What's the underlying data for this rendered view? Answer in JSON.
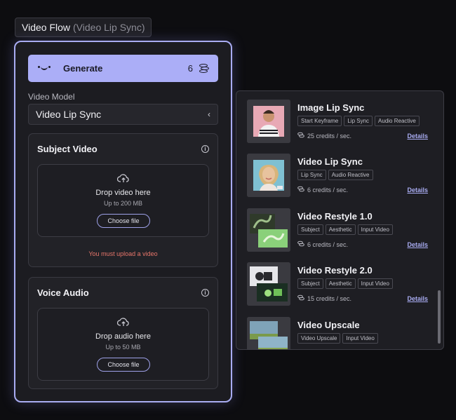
{
  "header": {
    "title": "Video Flow",
    "subtitle": "(Video Lip Sync)"
  },
  "generate": {
    "label": "Generate",
    "count": "6"
  },
  "model": {
    "label": "Video Model",
    "value": "Video Lip Sync"
  },
  "subject": {
    "title": "Subject Video",
    "drop_text": "Drop video here",
    "limit": "Up to 200 MB",
    "choose": "Choose file",
    "error": "You must upload a video"
  },
  "voice": {
    "title": "Voice Audio",
    "drop_text": "Drop audio here",
    "limit": "Up to 50 MB",
    "choose": "Choose file"
  },
  "models": [
    {
      "name": "Image Lip Sync",
      "tags": [
        "Start Keyframe",
        "Lip Sync",
        "Audio Reactive"
      ],
      "credits": "25 credits / sec.",
      "details": "Details"
    },
    {
      "name": "Video Lip Sync",
      "tags": [
        "Lip Sync",
        "Audio Reactive"
      ],
      "credits": "6 credits / sec.",
      "details": "Details"
    },
    {
      "name": "Video Restyle 1.0",
      "tags": [
        "Subject",
        "Aesthetic",
        "Input Video"
      ],
      "credits": "6 credits / sec.",
      "details": "Details"
    },
    {
      "name": "Video Restyle 2.0",
      "tags": [
        "Subject",
        "Aesthetic",
        "Input Video"
      ],
      "credits": "15 credits / sec.",
      "details": "Details"
    },
    {
      "name": "Video Upscale",
      "tags": [
        "Video Upscale",
        "Input Video"
      ],
      "credits": "",
      "details": ""
    }
  ],
  "colors": {
    "accent": "#a9acf2",
    "error": "#e8766b",
    "background": "#0d0d10"
  }
}
